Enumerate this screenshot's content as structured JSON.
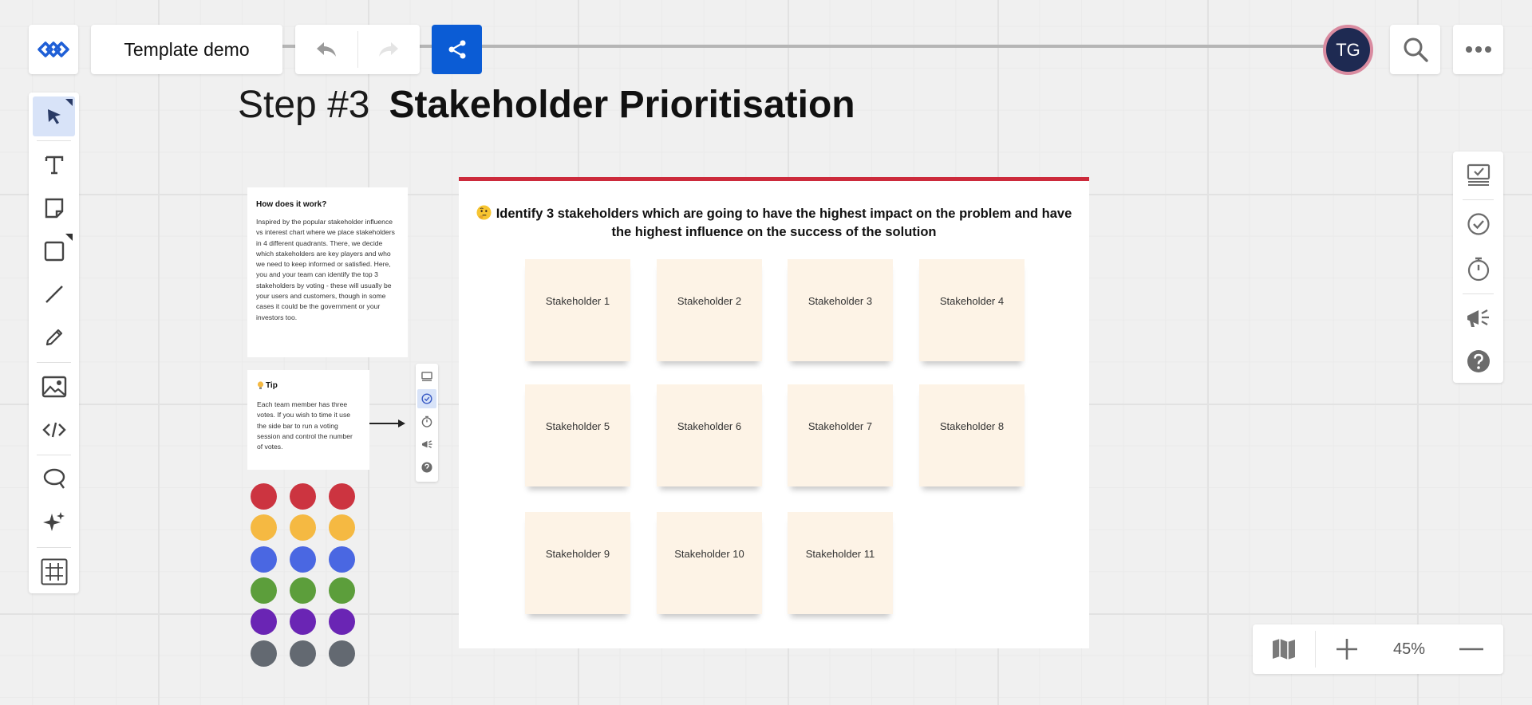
{
  "header": {
    "board_title": "Template demo",
    "avatar_initials": "TG",
    "undo_icon": "undo-icon",
    "redo_icon": "redo-icon",
    "share_icon": "share-icon",
    "search_icon": "search-icon",
    "more_icon": "more-icon",
    "accent_color": "#0b5cd5"
  },
  "left_toolbar": {
    "tools": [
      "select-icon",
      "text-icon",
      "sticky-note-icon",
      "shape-icon",
      "line-icon",
      "pen-icon",
      "image-icon",
      "embed-icon",
      "lasso-icon",
      "ai-sparkle-icon",
      "frame-icon"
    ]
  },
  "right_toolbar": {
    "tools": [
      "present-icon",
      "voting-icon",
      "timer-icon",
      "announce-icon",
      "help-icon"
    ]
  },
  "zoom": {
    "level": "45%",
    "map_icon": "map-icon",
    "zoom_in_icon": "plus-icon",
    "zoom_out_icon": "minus-icon"
  },
  "canvas": {
    "step": "Step #3",
    "title": "Stakeholder Prioritisation",
    "info": {
      "heading": "How does it work?",
      "body": "Inspired by the popular stakeholder influence vs interest chart where we place stakeholders in 4 different quadrants. There, we decide which stakeholders are key players and who we need to keep informed or satisfied. Here, you and your team can identify the top 3 stakeholders by voting - these will usually be your users and customers, though in some cases it could be the government or your investors too."
    },
    "tip": {
      "heading": "Tip",
      "body": "Each team member has three votes. If you wish to time it use the side bar to run a voting session and control the number of votes."
    },
    "dot_colors": [
      "#cc3440",
      "#f5b942",
      "#4a67e2",
      "#5c9e3b",
      "#6a25b4",
      "#636971"
    ],
    "frame": {
      "heading": "Identify 3 stakeholders which are going to have the highest impact on the problem and have the highest influence on the success of the solution",
      "frame_color": "#cc2a3b",
      "sticky_color": "#fdf3e6",
      "stickies": [
        "Stakeholder 1",
        "Stakeholder 2",
        "Stakeholder 3",
        "Stakeholder 4",
        "Stakeholder 5",
        "Stakeholder 6",
        "Stakeholder 7",
        "Stakeholder 8",
        "Stakeholder 9",
        "Stakeholder 10",
        "Stakeholder 11"
      ]
    }
  }
}
